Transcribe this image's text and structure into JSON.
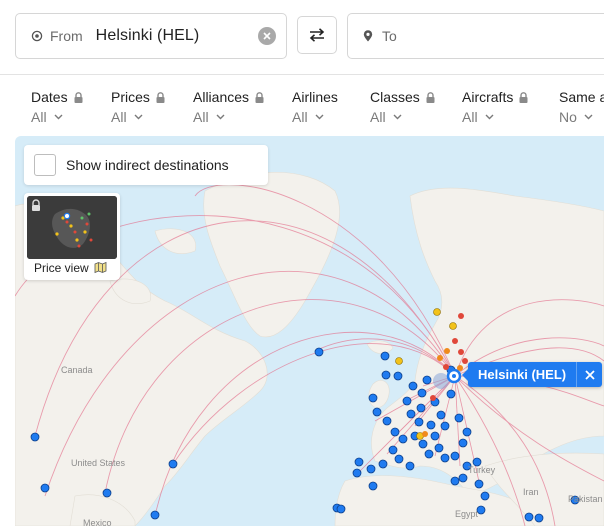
{
  "search": {
    "from_prefix": "From",
    "from_value": "Helsinki (HEL)",
    "to_placeholder": "To"
  },
  "filters": [
    {
      "title": "Dates",
      "value": "All",
      "locked": true
    },
    {
      "title": "Prices",
      "value": "All",
      "locked": true
    },
    {
      "title": "Alliances",
      "value": "All",
      "locked": true
    },
    {
      "title": "Airlines",
      "value": "All",
      "locked": false
    },
    {
      "title": "Classes",
      "value": "All",
      "locked": true
    },
    {
      "title": "Aircrafts",
      "value": "All",
      "locked": true
    },
    {
      "title": "Same a",
      "value": "No",
      "locked": false
    }
  ],
  "map": {
    "indirect_label": "Show indirect destinations",
    "price_view_label": "Price view",
    "selected_airport_label": "Helsinki (HEL)",
    "place_labels": {
      "canada": "Canada",
      "united_states": "United States",
      "mexico": "Mexico",
      "turkey": "Turkey",
      "egypt": "Egypt",
      "iran": "Iran",
      "pakistan": "Pakistan"
    },
    "colors": {
      "water": "#d6ecf8",
      "land": "#f3f1ec",
      "route": "#e36e8a",
      "dest_blue": "#1f7bf0",
      "dest_yellow": "#f2c21a",
      "dest_orange": "#f08a1c",
      "dest_red": "#e0483a",
      "tag_blue": "#1f7bf0"
    }
  }
}
